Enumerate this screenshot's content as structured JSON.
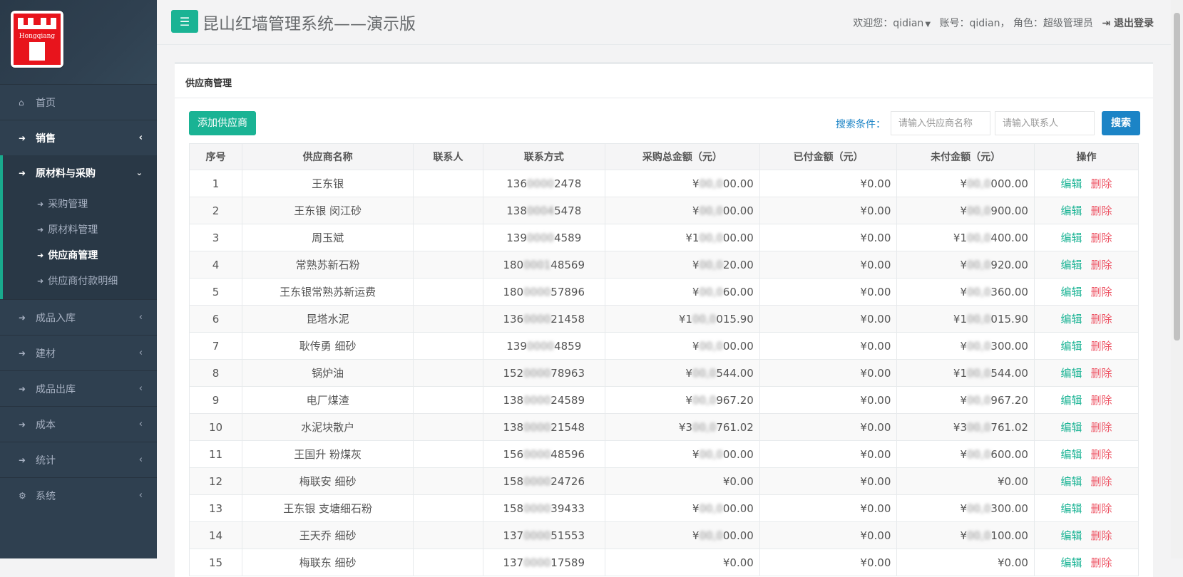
{
  "app": {
    "title": "昆山红墙管理系统——演示版",
    "logo_text": "Hongqiang"
  },
  "user": {
    "welcome": "欢迎您：qidian",
    "account": "账号：qidian， 角色：超级管理员",
    "logout": "退出登录"
  },
  "sidebar": {
    "home": "首页",
    "sales": "销售",
    "materials": "原材料与采购",
    "sub": [
      "采购管理",
      "原材料管理",
      "供应商管理",
      "供应商付款明细"
    ],
    "others": [
      "成品入库",
      "建材",
      "成品出库",
      "成本",
      "统计",
      "系统"
    ]
  },
  "panel": {
    "title": "供应商管理",
    "add_button": "添加供应商",
    "search_label": "搜索条件：",
    "supplier_placeholder": "请输入供应商名称",
    "contact_placeholder": "请输入联系人",
    "search_button": "搜索"
  },
  "table": {
    "headers": [
      "序号",
      "供应商名称",
      "联系人",
      "联系方式",
      "采购总金额（元）",
      "已付金额（元）",
      "未付金额（元）",
      "操作"
    ],
    "edit_label": "编辑",
    "delete_label": "删除",
    "rows": [
      {
        "no": "1",
        "name": "王东银",
        "contact": "",
        "phone_a": "136",
        "phone_m": "0000",
        "phone_b": "2478",
        "total_a": "¥",
        "total_m": "00,0",
        "total_b": "00.00",
        "paid": "¥0.00",
        "unpaid_a": "¥",
        "unpaid_m": "00,0",
        "unpaid_b": "000.00"
      },
      {
        "no": "2",
        "name": "王东银 闵江砂",
        "contact": "",
        "phone_a": "138",
        "phone_m": "0004",
        "phone_b": "5478",
        "total_a": "¥",
        "total_m": "00,0",
        "total_b": "00.00",
        "paid": "¥0.00",
        "unpaid_a": "¥",
        "unpaid_m": "00,0",
        "unpaid_b": "900.00"
      },
      {
        "no": "3",
        "name": "周玉斌",
        "contact": "",
        "phone_a": "139",
        "phone_m": "0000",
        "phone_b": "4589",
        "total_a": "¥1",
        "total_m": "00,0",
        "total_b": "00.00",
        "paid": "¥0.00",
        "unpaid_a": "¥1",
        "unpaid_m": "00,0",
        "unpaid_b": "400.00"
      },
      {
        "no": "4",
        "name": "常熟苏新石粉",
        "contact": "",
        "phone_a": "180",
        "phone_m": "0001",
        "phone_b": "48569",
        "total_a": "¥",
        "total_m": "00,0",
        "total_b": "20.00",
        "paid": "¥0.00",
        "unpaid_a": "¥",
        "unpaid_m": "00,0",
        "unpaid_b": "920.00"
      },
      {
        "no": "5",
        "name": "王东银常熟苏新运费",
        "contact": "",
        "phone_a": "180",
        "phone_m": "0000",
        "phone_b": "57896",
        "total_a": "¥",
        "total_m": "00,0",
        "total_b": "60.00",
        "paid": "¥0.00",
        "unpaid_a": "¥",
        "unpaid_m": "00,0",
        "unpaid_b": "360.00"
      },
      {
        "no": "6",
        "name": "昆塔水泥",
        "contact": "",
        "phone_a": "136",
        "phone_m": "0000",
        "phone_b": "21458",
        "total_a": "¥1",
        "total_m": "00,0",
        "total_b": "015.90",
        "paid": "¥0.00",
        "unpaid_a": "¥1",
        "unpaid_m": "00,0",
        "unpaid_b": "015.90"
      },
      {
        "no": "7",
        "name": "耿传勇 细砂",
        "contact": "",
        "phone_a": "139",
        "phone_m": "0000",
        "phone_b": "4859",
        "total_a": "¥",
        "total_m": "00,0",
        "total_b": "00.00",
        "paid": "¥0.00",
        "unpaid_a": "¥",
        "unpaid_m": "00,0",
        "unpaid_b": "300.00"
      },
      {
        "no": "8",
        "name": "锅炉油",
        "contact": "",
        "phone_a": "152",
        "phone_m": "0000",
        "phone_b": "78963",
        "total_a": "¥",
        "total_m": "00,0",
        "total_b": "544.00",
        "paid": "¥0.00",
        "unpaid_a": "¥1",
        "unpaid_m": "00,0",
        "unpaid_b": "544.00"
      },
      {
        "no": "9",
        "name": "电厂煤渣",
        "contact": "",
        "phone_a": "138",
        "phone_m": "0000",
        "phone_b": "24589",
        "total_a": "¥",
        "total_m": "00,0",
        "total_b": "967.20",
        "paid": "¥0.00",
        "unpaid_a": "¥",
        "unpaid_m": "00,0",
        "unpaid_b": "967.20"
      },
      {
        "no": "10",
        "name": "水泥块散户",
        "contact": "",
        "phone_a": "138",
        "phone_m": "0000",
        "phone_b": "21548",
        "total_a": "¥3",
        "total_m": "00,0",
        "total_b": "761.02",
        "paid": "¥0.00",
        "unpaid_a": "¥3",
        "unpaid_m": "00,0",
        "unpaid_b": "761.02"
      },
      {
        "no": "11",
        "name": "王国升 粉煤灰",
        "contact": "",
        "phone_a": "156",
        "phone_m": "0000",
        "phone_b": "48596",
        "total_a": "¥",
        "total_m": "00,0",
        "total_b": "00.00",
        "paid": "¥0.00",
        "unpaid_a": "¥",
        "unpaid_m": "00,0",
        "unpaid_b": "600.00"
      },
      {
        "no": "12",
        "name": "梅联安 细砂",
        "contact": "",
        "phone_a": "158",
        "phone_m": "0000",
        "phone_b": "24726",
        "total_a": "",
        "total_m": "",
        "total_b": "¥0.00",
        "paid": "¥0.00",
        "unpaid_a": "",
        "unpaid_m": "",
        "unpaid_b": "¥0.00"
      },
      {
        "no": "13",
        "name": "王东银 支塘细石粉",
        "contact": "",
        "phone_a": "158",
        "phone_m": "0000",
        "phone_b": "39433",
        "total_a": "¥",
        "total_m": "00,0",
        "total_b": "00.00",
        "paid": "¥0.00",
        "unpaid_a": "¥",
        "unpaid_m": "00,0",
        "unpaid_b": "300.00"
      },
      {
        "no": "14",
        "name": "王天乔 细砂",
        "contact": "",
        "phone_a": "137",
        "phone_m": "0000",
        "phone_b": "51553",
        "total_a": "¥",
        "total_m": "00,0",
        "total_b": "00.00",
        "paid": "¥0.00",
        "unpaid_a": "¥",
        "unpaid_m": "00,0",
        "unpaid_b": "100.00"
      },
      {
        "no": "15",
        "name": "梅联东 细砂",
        "contact": "",
        "phone_a": "137",
        "phone_m": "0000",
        "phone_b": "17589",
        "total_a": "",
        "total_m": "",
        "total_b": "¥0.00",
        "paid": "¥0.00",
        "unpaid_a": "",
        "unpaid_m": "",
        "unpaid_b": "¥0.00"
      }
    ]
  }
}
